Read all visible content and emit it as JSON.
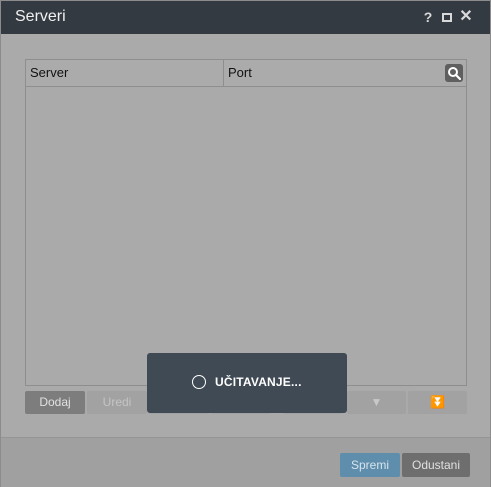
{
  "window": {
    "title": "Serveri",
    "controls": {
      "help": "?",
      "close": "✕"
    }
  },
  "grid": {
    "columns": [
      "Server",
      "Port"
    ],
    "rows": []
  },
  "toolbar": {
    "add_label": "Dodaj",
    "edit_label": "Uredi",
    "move_down_glyph": "▼",
    "move_bottom_glyph": "⏬"
  },
  "footer": {
    "save_label": "Spremi",
    "cancel_label": "Odustani"
  },
  "loading": {
    "text": "UČITAVANJE..."
  },
  "colors": {
    "titlebar": "#343a42",
    "save_accent": "#5e8eac",
    "overlay": "#404a54"
  }
}
